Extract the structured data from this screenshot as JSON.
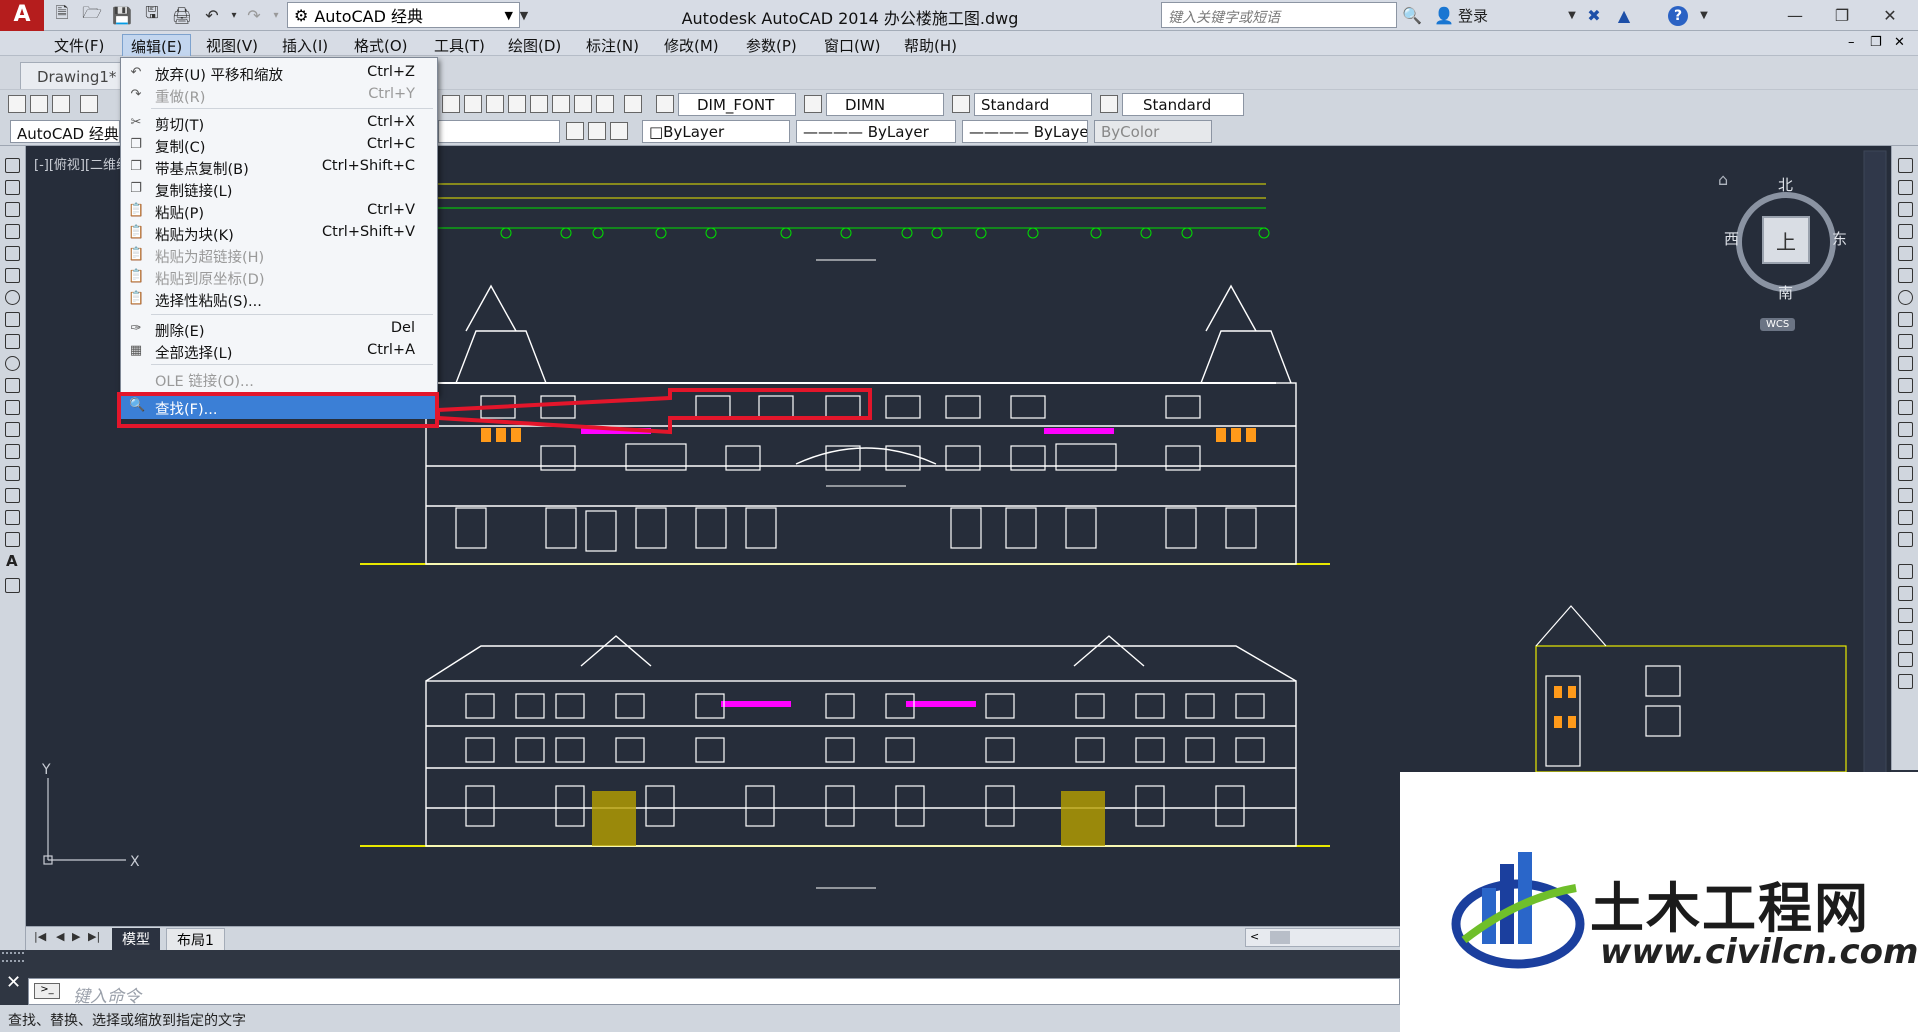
{
  "titlebar": {
    "workspace": "AutoCAD 经典",
    "title": "Autodesk AutoCAD 2014    办公楼施工图.dwg",
    "search_placeholder": "键入关键字或短语",
    "login": "登录"
  },
  "menubar": [
    "文件(F)",
    "编辑(E)",
    "视图(V)",
    "插入(I)",
    "格式(O)",
    "工具(T)",
    "绘图(D)",
    "标注(N)",
    "修改(M)",
    "参数(P)",
    "窗口(W)",
    "帮助(H)"
  ],
  "doc_tab": "Drawing1*",
  "toolbar1": {
    "text_style": "DIM_FONT",
    "dim_style": "DIMN",
    "table_style": "Standard",
    "mleader_style": "Standard"
  },
  "toolbar2": {
    "workspace": "AutoCAD 经典",
    "layer_color": "□ByLayer",
    "linetype": "———— ByLayer",
    "lineweight": "———— ByLayer",
    "plotstyle": "ByColor"
  },
  "viewport_label": "[-][俯视][二维线框]",
  "edit_menu": [
    {
      "label": "放弃(U) 平移和缩放",
      "shortcut": "Ctrl+Z",
      "enabled": true
    },
    {
      "label": "重做(R)",
      "shortcut": "Ctrl+Y",
      "enabled": false
    },
    {
      "label": "剪切(T)",
      "shortcut": "Ctrl+X",
      "enabled": true
    },
    {
      "label": "复制(C)",
      "shortcut": "Ctrl+C",
      "enabled": true
    },
    {
      "label": "带基点复制(B)",
      "shortcut": "Ctrl+Shift+C",
      "enabled": true
    },
    {
      "label": "复制链接(L)",
      "shortcut": "",
      "enabled": true
    },
    {
      "label": "粘贴(P)",
      "shortcut": "Ctrl+V",
      "enabled": true
    },
    {
      "label": "粘贴为块(K)",
      "shortcut": "Ctrl+Shift+V",
      "enabled": true
    },
    {
      "label": "粘贴为超链接(H)",
      "shortcut": "",
      "enabled": false
    },
    {
      "label": "粘贴到原坐标(D)",
      "shortcut": "",
      "enabled": false
    },
    {
      "label": "选择性粘贴(S)...",
      "shortcut": "",
      "enabled": true
    },
    {
      "label": "删除(E)",
      "shortcut": "Del",
      "enabled": true
    },
    {
      "label": "全部选择(L)",
      "shortcut": "Ctrl+A",
      "enabled": true
    },
    {
      "label": "OLE 链接(O)...",
      "shortcut": "",
      "enabled": false
    },
    {
      "label": "查找(F)...",
      "shortcut": "",
      "enabled": true,
      "highlighted": true
    }
  ],
  "viewcube": {
    "north": "北",
    "south": "南",
    "west": "西",
    "east": "东",
    "top": "上",
    "wcs": "WCS"
  },
  "layout_tabs": [
    "模型",
    "布局1"
  ],
  "command_placeholder": "键入命令",
  "status_text": "查找、替换、选择或缩放到指定的文字",
  "watermark": {
    "name": "土木工程网",
    "url": "www.civilcn.com"
  },
  "colors": {
    "canvas": "#262d3a",
    "drawing_white": "#ffffff",
    "drawing_yellow": "#e8e800",
    "drawing_green": "#00e000",
    "drawing_magenta": "#ff00ff",
    "drawing_orange": "#ff9a1a",
    "highlight_red": "#e3162b",
    "menu_selection": "#3b7fd6"
  }
}
